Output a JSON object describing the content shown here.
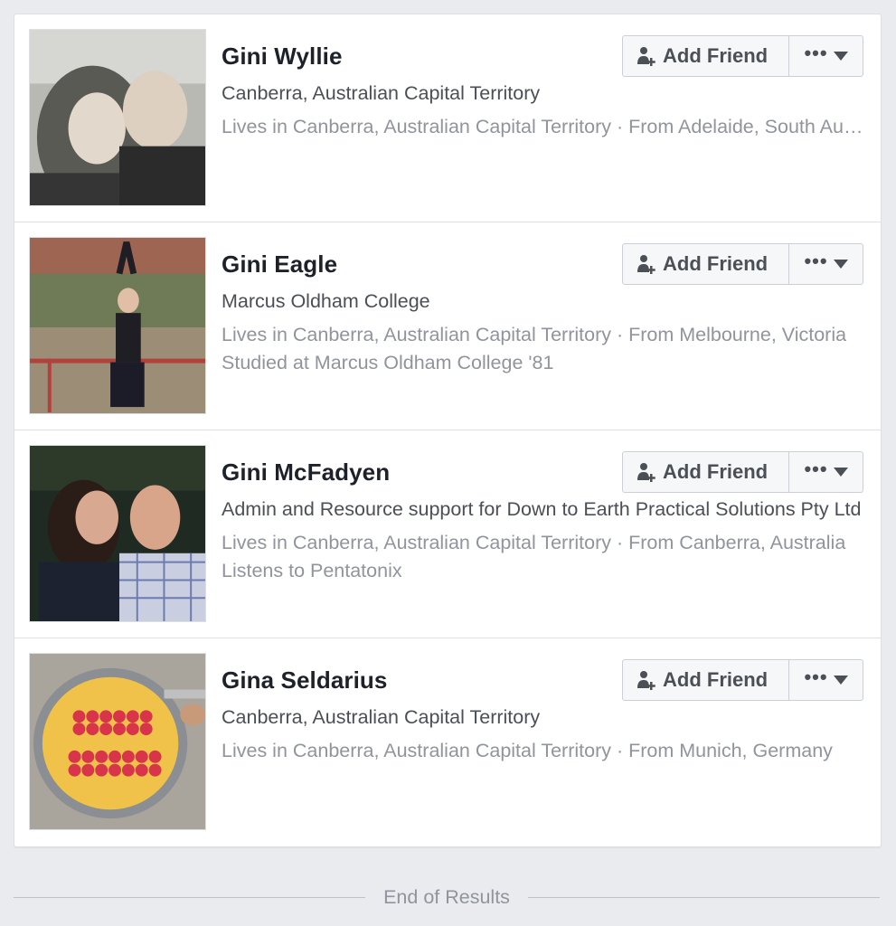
{
  "results": [
    {
      "name": "Gini Wyllie",
      "primary": "Canberra, Australian Capital Territory",
      "secondary": [
        "Lives in Canberra, Australian Capital Territory · From Adelaide, South Australia"
      ]
    },
    {
      "name": "Gini Eagle",
      "primary": "Marcus Oldham College",
      "secondary": [
        "Lives in Canberra, Australian Capital Territory · From Melbourne, Victoria",
        "Studied at Marcus Oldham College '81"
      ]
    },
    {
      "name": "Gini McFadyen",
      "primary": "Admin and Resource support for Down to Earth Practical Solutions Pty Ltd",
      "secondary": [
        "Lives in Canberra, Australian Capital Territory · From Canberra, Australia",
        "Listens to Pentatonix"
      ]
    },
    {
      "name": "Gina Seldarius",
      "primary": "Canberra, Australian Capital Territory",
      "secondary": [
        "Lives in Canberra, Australian Capital Territory · From Munich, Germany"
      ]
    }
  ],
  "buttons": {
    "add_friend": "Add Friend",
    "more": "•••"
  },
  "end_label": "End of Results",
  "icons": {
    "add_friend": "add-friend-icon",
    "more": "caret-down-icon"
  },
  "colors": {
    "name": "#1d2129",
    "primary_text": "#4b4f56",
    "secondary_text": "#90949c",
    "page_bg": "#e9ebee"
  }
}
